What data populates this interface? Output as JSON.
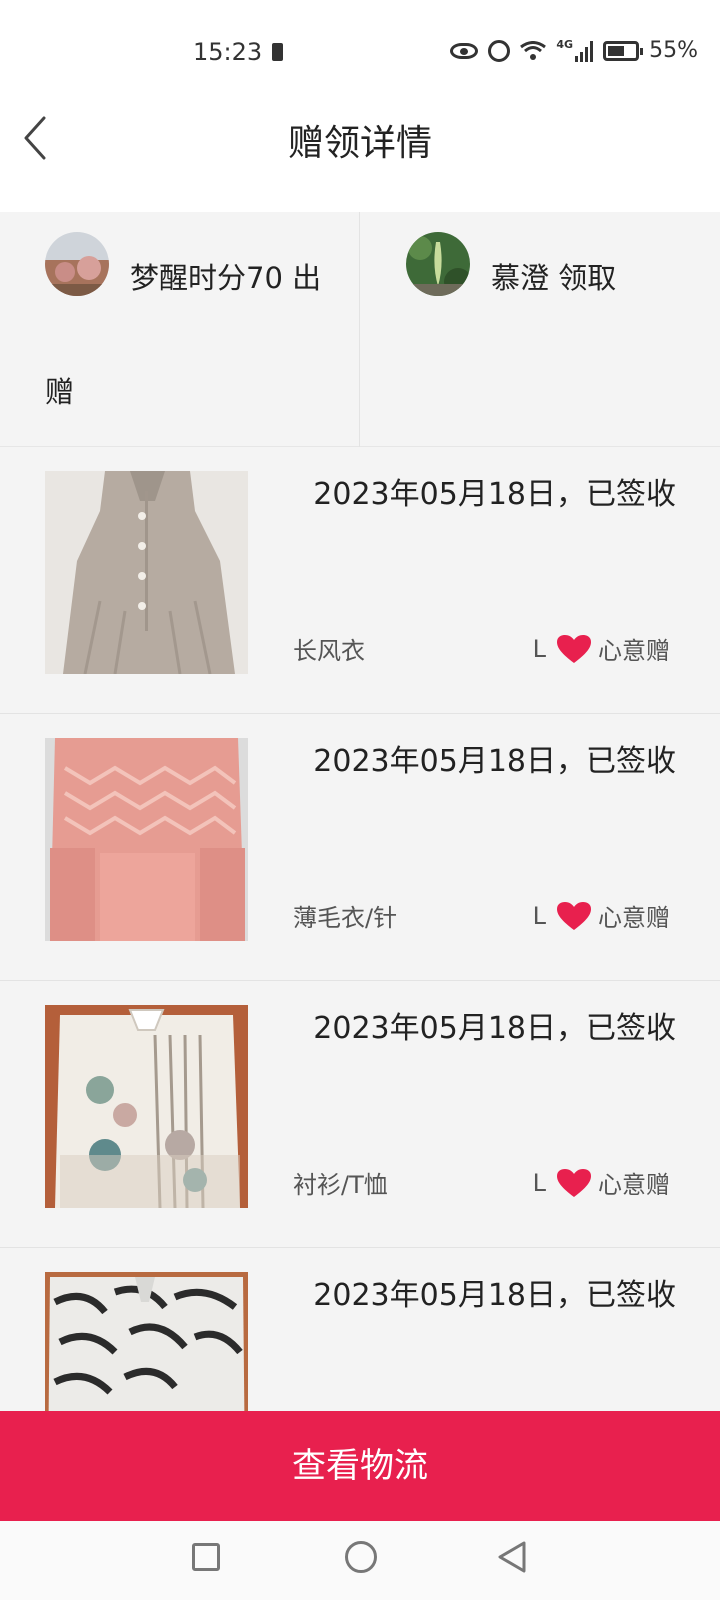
{
  "status_bar": {
    "time": "15:23",
    "network": "4G",
    "battery": "55%"
  },
  "nav": {
    "title": "赠领详情"
  },
  "giver": {
    "name_line1": "梦醒时分70 出",
    "name_line2": "赠"
  },
  "receiver": {
    "text": "慕澄 领取"
  },
  "items": [
    {
      "date_status": "2023年05月18日，已签收",
      "name": "长风衣",
      "size": "L",
      "tag": "心意赠"
    },
    {
      "date_status": "2023年05月18日，已签收",
      "name": "薄毛衣/针",
      "size": "L",
      "tag": "心意赠"
    },
    {
      "date_status": "2023年05月18日，已签收",
      "name": "衬衫/T恤",
      "size": "L",
      "tag": "心意赠"
    },
    {
      "date_status": "2023年05月18日，已签收",
      "name": "",
      "size": "",
      "tag": ""
    }
  ],
  "actions": {
    "view_logistics": "查看物流"
  },
  "colors": {
    "accent": "#e8204e",
    "heart": "#e8204e",
    "background": "#f4f4f4"
  }
}
